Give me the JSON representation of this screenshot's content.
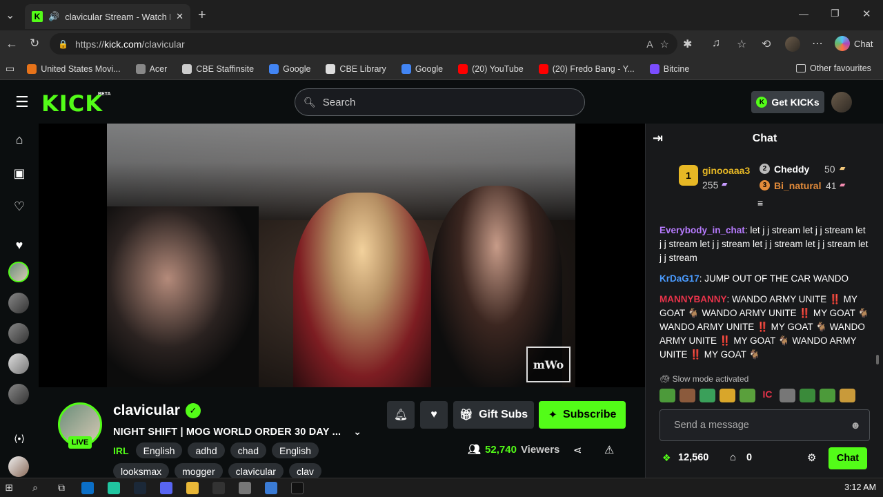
{
  "browser": {
    "tab_title": "clavicular Stream - Watch Live",
    "url_prefix": "https://",
    "url_host": "kick.com",
    "url_path": "/clavicular",
    "chat_label": "Chat",
    "bookmarks": [
      {
        "label": "United States Movi...",
        "color": "#e7731a"
      },
      {
        "label": "Acer",
        "color": "#888888"
      },
      {
        "label": "CBE Staffinsite",
        "color": "#cccccc"
      },
      {
        "label": "Google",
        "color": "#4285f4"
      },
      {
        "label": "CBE Library",
        "color": "#dddddd"
      },
      {
        "label": "Google",
        "color": "#4285f4"
      },
      {
        "label": "(20) YouTube",
        "color": "#ff0000"
      },
      {
        "label": "(20) Fredo Bang - Y...",
        "color": "#ff0000"
      },
      {
        "label": "Bitcine",
        "color": "#7b4dff"
      }
    ],
    "other_favourites": "Other favourites"
  },
  "kick": {
    "logo": "KICK",
    "beta": "BETA",
    "search_placeholder": "Search",
    "get_kicks": "Get KICKs",
    "accent": "#53fc18"
  },
  "stream": {
    "streamer": "clavicular",
    "live_label": "LIVE",
    "title": "NIGHT SHIFT | MOG WORLD ORDER 30 DAY ...",
    "category": "IRL",
    "tags_row1": [
      "English",
      "adhd",
      "chad",
      "English"
    ],
    "tags_row2": [
      "looksmax",
      "mogger",
      "clavicular",
      "clav"
    ],
    "gift_subs": "Gift Subs",
    "subscribe": "Subscribe",
    "viewers_count": "52,740",
    "viewers_label": "Viewers",
    "watermark": "mWo"
  },
  "chat": {
    "title": "Chat",
    "leaderboard": {
      "first": {
        "rank": "1",
        "name": "ginooaaa3",
        "count": "255"
      },
      "second": {
        "rank": "2",
        "name": "Cheddy",
        "count": "50"
      },
      "third": {
        "rank": "3",
        "name": "Bi_natural",
        "count": "41"
      }
    },
    "messages": [
      {
        "user": "Everybody_in_chat",
        "color": "#b77bff",
        "text": "let j j stream let j j stream let j j stream let j j stream let j j stream let j j stream let j j stream"
      },
      {
        "user": "KrDaG17",
        "color": "#4a9bff",
        "text": "JUMP OUT OF THE CAR WANDO"
      },
      {
        "user": "MANNYBANNY",
        "color": "#e8334a",
        "text": "WANDO ARMY UNITE ‼️ MY GOAT 🐐 WANDO ARMY UNITE ‼️ MY GOAT 🐐 WANDO ARMY UNITE ‼️ MY GOAT 🐐 WANDO ARMY UNITE ‼️ MY GOAT 🐐 WANDO ARMY UNITE ‼️ MY GOAT 🐐"
      }
    ],
    "slow_mode": "Slow mode activated",
    "input_placeholder": "Send a message",
    "points": "12,560",
    "store_count": "0",
    "send_label": "Chat"
  },
  "taskbar": {
    "clock": "3:12 AM"
  }
}
